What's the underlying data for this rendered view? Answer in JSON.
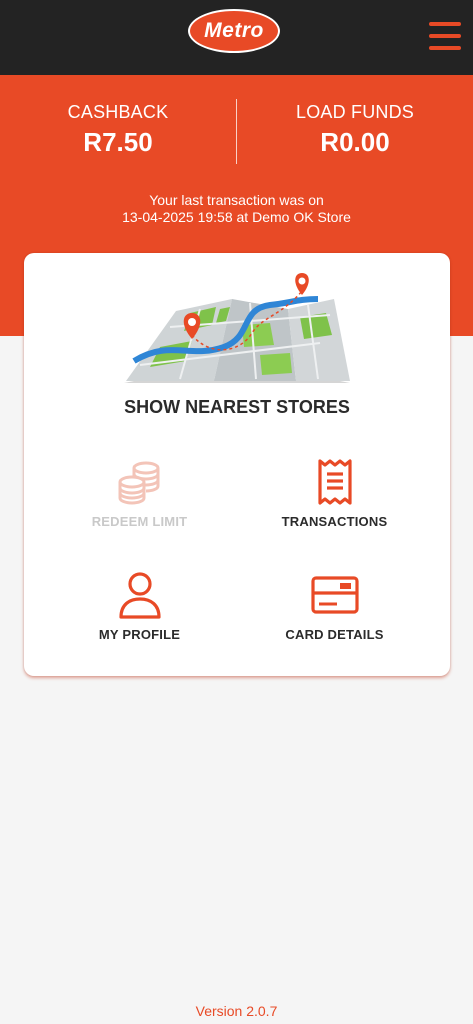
{
  "header": {
    "logo_text": "Metro",
    "menu_icon": "hamburger-menu-icon"
  },
  "balances": {
    "cashback_label": "CASHBACK",
    "cashback_value": "R7.50",
    "load_funds_label": "LOAD FUNDS",
    "load_funds_value": "R0.00"
  },
  "last_transaction": {
    "line1": "Your last transaction was on",
    "line2": "13-04-2025 19:58 at Demo OK Store"
  },
  "card": {
    "nearest_label": "SHOW NEAREST STORES",
    "tiles": [
      {
        "label": "REDEEM LIMIT",
        "icon": "coins-icon",
        "disabled": true
      },
      {
        "label": "TRANSACTIONS",
        "icon": "receipt-icon",
        "disabled": false
      },
      {
        "label": "MY PROFILE",
        "icon": "user-icon",
        "disabled": false
      },
      {
        "label": "CARD DETAILS",
        "icon": "credit-card-icon",
        "disabled": false
      }
    ]
  },
  "footer": {
    "version": "Version 2.0.7"
  },
  "colors": {
    "accent": "#e84a26",
    "topbar": "#232323",
    "background": "#f5f5f5",
    "disabled": "#f3c4b8"
  }
}
